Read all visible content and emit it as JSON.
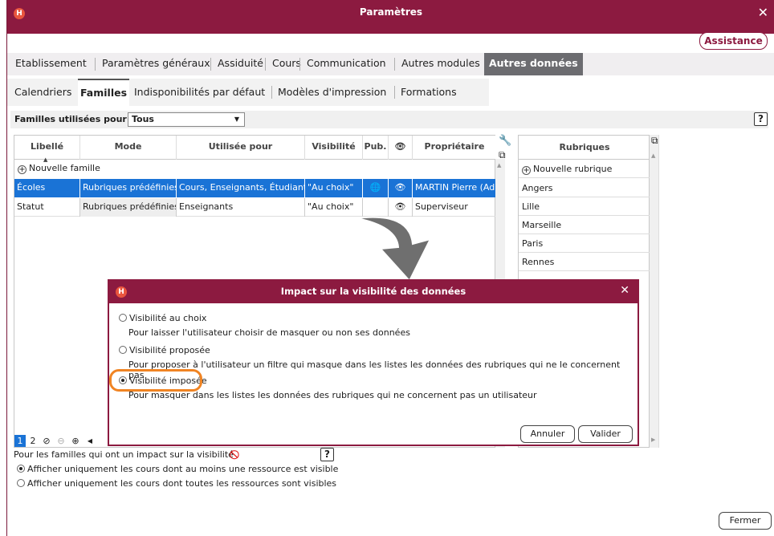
{
  "window": {
    "title": "Paramètres",
    "assist_label": "Assistance",
    "close_icon": "close-icon"
  },
  "tabs_main": [
    "Etablissement",
    "Paramètres généraux",
    "Assiduité",
    "Cours",
    "Communication",
    "Autres modules",
    "Autres données"
  ],
  "tabs_sub": [
    "Calendriers",
    "Familles",
    "Indisponibilités par défaut",
    "Modèles d'impression",
    "Formations"
  ],
  "filter": {
    "label": "Familles utilisées pour",
    "value": "Tous"
  },
  "grid": {
    "headers": [
      "Libellé",
      "Mode",
      "Utilisée pour",
      "Visibilité",
      "Pub.",
      "",
      "Propriétaire"
    ],
    "new_label": "Nouvelle famille",
    "rows": [
      [
        "Écoles",
        "Rubriques prédéfinies",
        "Cours, Enseignants, Étudiants",
        "\"Au choix\"",
        "",
        "",
        "MARTIN Pierre (Adr"
      ],
      [
        "Statut",
        "Rubriques prédéfinies",
        "Enseignants",
        "\"Au choix\"",
        "",
        "",
        "Superviseur"
      ]
    ]
  },
  "rubriques": {
    "header": "Rubriques",
    "new_label": "Nouvelle rubrique",
    "items": [
      "Angers",
      "Lille",
      "Marseille",
      "Paris",
      "Rennes"
    ]
  },
  "pager": {
    "pages": [
      "1",
      "2"
    ]
  },
  "bottom": {
    "intro": "Pour les familles qui ont un impact sur la visibilité",
    "opt1": "Afficher uniquement les cours dont au moins une ressource est visible",
    "opt2": "Afficher uniquement les cours dont toutes les ressources sont visibles",
    "close_label": "Fermer"
  },
  "modal": {
    "title": "Impact sur la visibilité des données",
    "opt1": "Visibilité au choix",
    "desc1": "Pour laisser l'utilisateur choisir de masquer ou non ses données",
    "opt2": "Visibilité proposée",
    "desc2": "Pour proposer à l'utilisateur un filtre qui masque dans les listes les données des rubriques qui ne le concernent pas",
    "opt3": "Visibilité imposée",
    "desc3": "Pour masquer dans les listes les données des rubriques  qui ne concernent pas un utilisateur",
    "cancel": "Annuler",
    "ok": "Valider"
  },
  "colors": {
    "brand": "#8c1a40",
    "selection": "#1a73d6",
    "highlight": "#f08423"
  }
}
